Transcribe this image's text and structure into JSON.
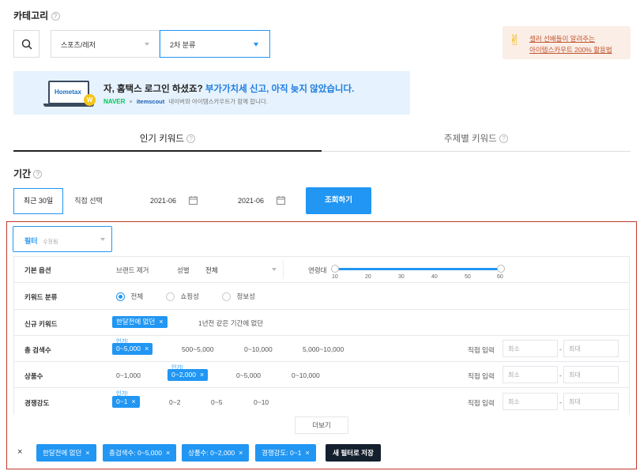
{
  "category": {
    "title": "카테고리",
    "primary": "스포츠/레저",
    "secondary": "2차 분류"
  },
  "promo": {
    "line1": "셀러 선배들이 알려주는",
    "line2": "아이템스카우트 200% 활용법"
  },
  "banner": {
    "headline_prefix": "자, 홈택스 로그인 하셨죠? ",
    "headline_highlight": "부가가치세 신고, 아직 늦지 않았습니다.",
    "naver": "NAVER",
    "times": "×",
    "itemscout": "itemscout",
    "sub": "네이버와 아이템스카우트가 함께 합니다.",
    "hometax": "Hometax"
  },
  "tabs": [
    {
      "label": "인기 키워드"
    },
    {
      "label": "주제별 키워드"
    }
  ],
  "period": {
    "title": "기간",
    "recent": "최근 30일",
    "custom": "직접 선택",
    "start": "2021-06",
    "end": "2021-06",
    "search": "조회하기"
  },
  "filter": {
    "label": "필터",
    "sub": "수정됨"
  },
  "rows": {
    "basic": {
      "label": "기본 옵션",
      "brand": "브랜드 제거",
      "gender_label": "성별",
      "gender_value": "전체",
      "age_label": "연령대",
      "ticks": [
        "10",
        "20",
        "30",
        "40",
        "50",
        "60"
      ],
      "age_range": [
        10,
        60
      ]
    },
    "kwtype": {
      "label": "키워드 분류",
      "opts": [
        "전체",
        "쇼핑성",
        "정보성"
      ]
    },
    "new": {
      "label": "신규 키워드",
      "chip": "한달전에 없던",
      "opt": "1년전 같은 기간에 없던"
    },
    "search": {
      "label": "총 검색수",
      "popular": "인기!",
      "chip": "0~5,000",
      "opts": [
        "500~5,000",
        "0~10,000",
        "5,000~10,000"
      ],
      "direct": "직접 입력",
      "min": "최소",
      "max": "최대",
      "dash": "-"
    },
    "products": {
      "label": "상품수",
      "popular": "인기!",
      "first": "0~1,000",
      "chip": "0~2,000",
      "opts": [
        "0~5,000",
        "0~10,000"
      ],
      "direct": "직접 입력",
      "min": "최소",
      "max": "최대",
      "dash": "-"
    },
    "competition": {
      "label": "경쟁강도",
      "popular": "인기!",
      "chip": "0~1",
      "opts": [
        "0~2",
        "0~5",
        "0~10"
      ],
      "direct": "직접 입력",
      "min": "최소",
      "max": "최대",
      "dash": "-"
    }
  },
  "more": "더보기",
  "applied": {
    "close": "×",
    "chips": [
      "한달전에 없던",
      "총검색수: 0~5,000",
      "상품수: 0~2,000",
      "경쟁강도: 0~1"
    ],
    "save": "새 필터로 저장"
  }
}
